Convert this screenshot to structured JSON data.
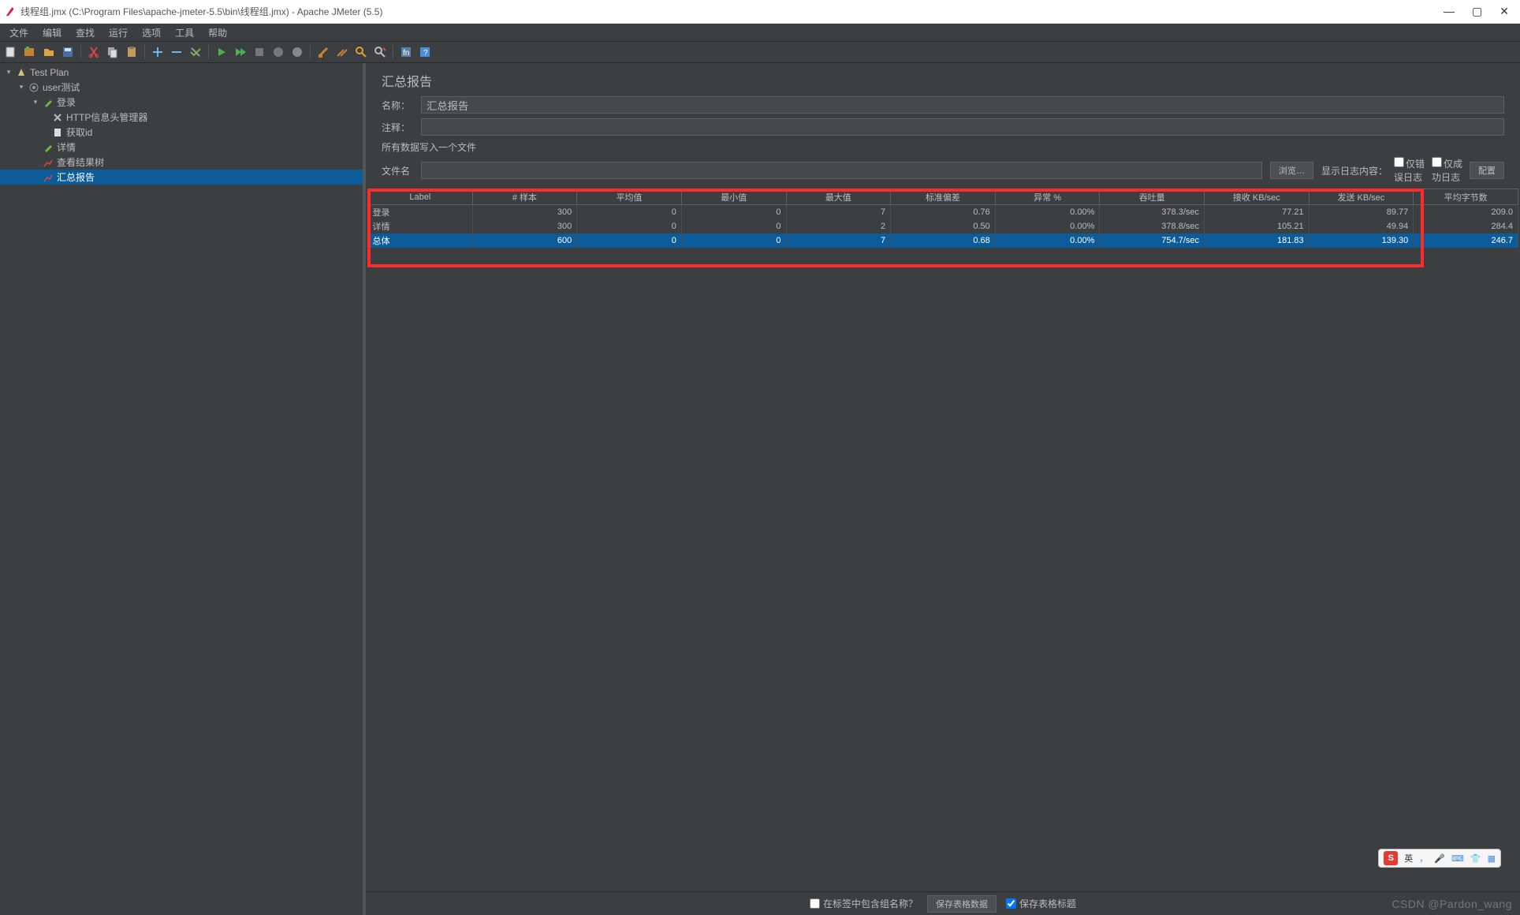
{
  "window": {
    "title": "线程组.jmx (C:\\Program Files\\apache-jmeter-5.5\\bin\\线程组.jmx) - Apache JMeter (5.5)"
  },
  "menu": {
    "items": [
      "文件",
      "编辑",
      "查找",
      "运行",
      "选项",
      "工具",
      "帮助"
    ]
  },
  "tree": {
    "root": "Test Plan",
    "items": [
      {
        "label": "user测试",
        "icon": "gear"
      },
      {
        "label": "登录",
        "icon": "pencil"
      },
      {
        "label": "HTTP信息头管理器",
        "icon": "x"
      },
      {
        "label": "获取id",
        "icon": "doc"
      },
      {
        "label": "详情",
        "icon": "pencil"
      },
      {
        "label": "查看结果树",
        "icon": "chart"
      },
      {
        "label": "汇总报告",
        "icon": "chart",
        "selected": true
      }
    ]
  },
  "panel": {
    "title": "汇总报告",
    "name_label": "名称：",
    "name_value": "汇总报告",
    "comment_label": "注释：",
    "comment_value": "",
    "write_section": "所有数据写入一个文件",
    "file_label": "文件名",
    "browse_btn": "浏览…",
    "log_label": "显示日志内容：",
    "err_only": "仅错误日志",
    "ok_only": "仅成功日志",
    "config_btn": "配置"
  },
  "table": {
    "headers": [
      "Label",
      "# 样本",
      "平均值",
      "最小值",
      "最大值",
      "标准偏差",
      "异常 %",
      "吞吐量",
      "接收 KB/sec",
      "发送 KB/sec",
      "平均字节数"
    ],
    "rows": [
      {
        "c": [
          "登录",
          "300",
          "0",
          "0",
          "7",
          "0.76",
          "0.00%",
          "378.3/sec",
          "77.21",
          "89.77",
          "209.0"
        ]
      },
      {
        "c": [
          "详情",
          "300",
          "0",
          "0",
          "2",
          "0.50",
          "0.00%",
          "378.8/sec",
          "105.21",
          "49.94",
          "284.4"
        ]
      },
      {
        "c": [
          "总体",
          "600",
          "0",
          "0",
          "7",
          "0.68",
          "0.00%",
          "754.7/sec",
          "181.83",
          "139.30",
          "246.7"
        ],
        "selected": true
      }
    ]
  },
  "bottom": {
    "include_group": "在标签中包含组名称？",
    "save_data_btn": "保存表格数据",
    "save_header": "保存表格标题"
  },
  "ime": {
    "lang": "英",
    "comma": "，"
  },
  "watermark": "CSDN @Pardon_wang"
}
